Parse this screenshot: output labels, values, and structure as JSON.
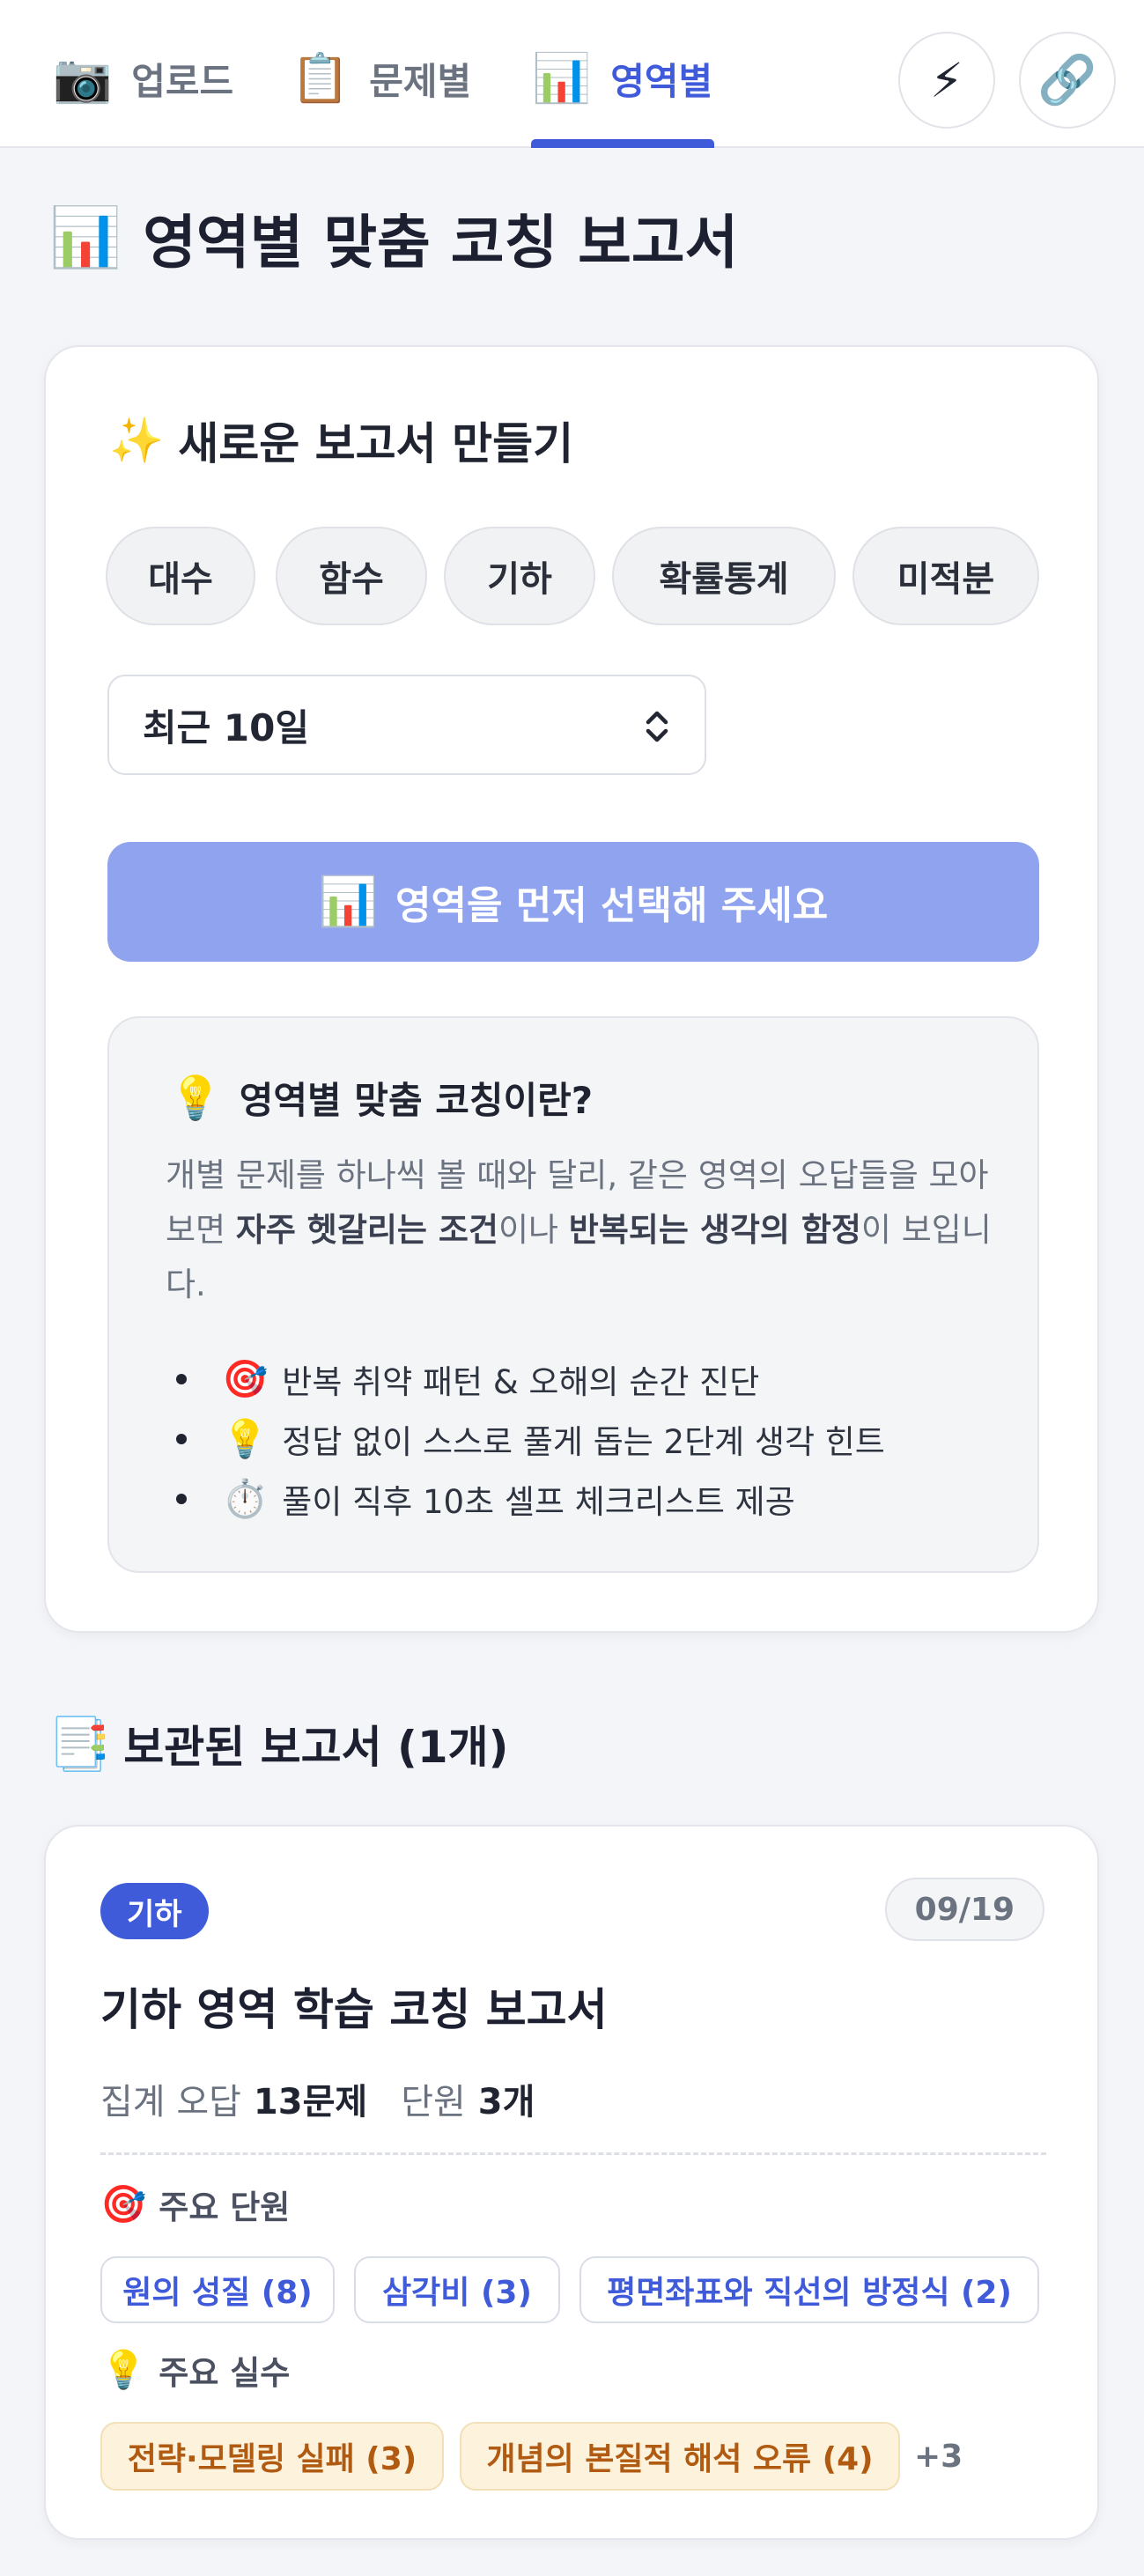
{
  "tabs": [
    {
      "icon": "📷",
      "label": "업로드"
    },
    {
      "icon": "📋",
      "label": "문제별"
    },
    {
      "icon": "📊",
      "label": "영역별"
    }
  ],
  "header_buttons": {
    "lightning_icon": "⚡",
    "link_icon": "🔗"
  },
  "page": {
    "icon": "📊",
    "title": "영역별 맞춤 코칭 보고서"
  },
  "new_report": {
    "icon": "✨",
    "title": "새로운 보고서 만들기",
    "areas": [
      "대수",
      "함수",
      "기하",
      "확률통계",
      "미적분"
    ],
    "period_selected": "최근 10일",
    "submit_icon": "📊",
    "submit_label": "영역을 먼저 선택해 주세요",
    "info": {
      "icon": "💡",
      "title": "영역별 맞춤 코칭이란?",
      "para_1": "개별 문제를 하나씩 볼 때와 달리, 같은 영역의 오답들을 모아보면 ",
      "para_bold_1": "자주 헷갈리는 조건",
      "para_2": "이나 ",
      "para_bold_2": "반복되는 생각의 함정",
      "para_3": "이 보입니다.",
      "bullets": [
        {
          "icon": "🎯",
          "text": "반복 취약 패턴 & 오해의 순간 진단"
        },
        {
          "icon": "💡",
          "text": "정답 없이 스스로 풀게 돕는 2단계 생각 힌트"
        },
        {
          "icon": "⏱️",
          "text": "풀이 직후 10초 셀프 체크리스트 제공"
        }
      ]
    }
  },
  "saved": {
    "icon": "📑",
    "title": "보관된 보고서 (1개)",
    "reports": [
      {
        "badge": "기하",
        "date": "09/19",
        "title": "기하 영역 학습 코칭 보고서",
        "wrong_label": "집계 오답",
        "wrong_value": "13문제",
        "unit_label": "단원",
        "unit_value": "3개",
        "units_heading_icon": "🎯",
        "units_heading": "주요 단원",
        "units": [
          "원의 성질 (8)",
          "삼각비 (3)",
          "평면좌표와 직선의 방정식 (2)"
        ],
        "mistakes_heading_icon": "💡",
        "mistakes_heading": "주요 실수",
        "mistakes": [
          "전략·모델링 실패 (3)",
          "개념의 본질적 해석 오류 (4)"
        ],
        "more": "+3"
      }
    ]
  },
  "colors": {
    "accent": "#3f5bd9",
    "button_disabled": "#8fa3ee",
    "mistake_bg": "#fdf2dc",
    "mistake_text": "#b15b12"
  }
}
